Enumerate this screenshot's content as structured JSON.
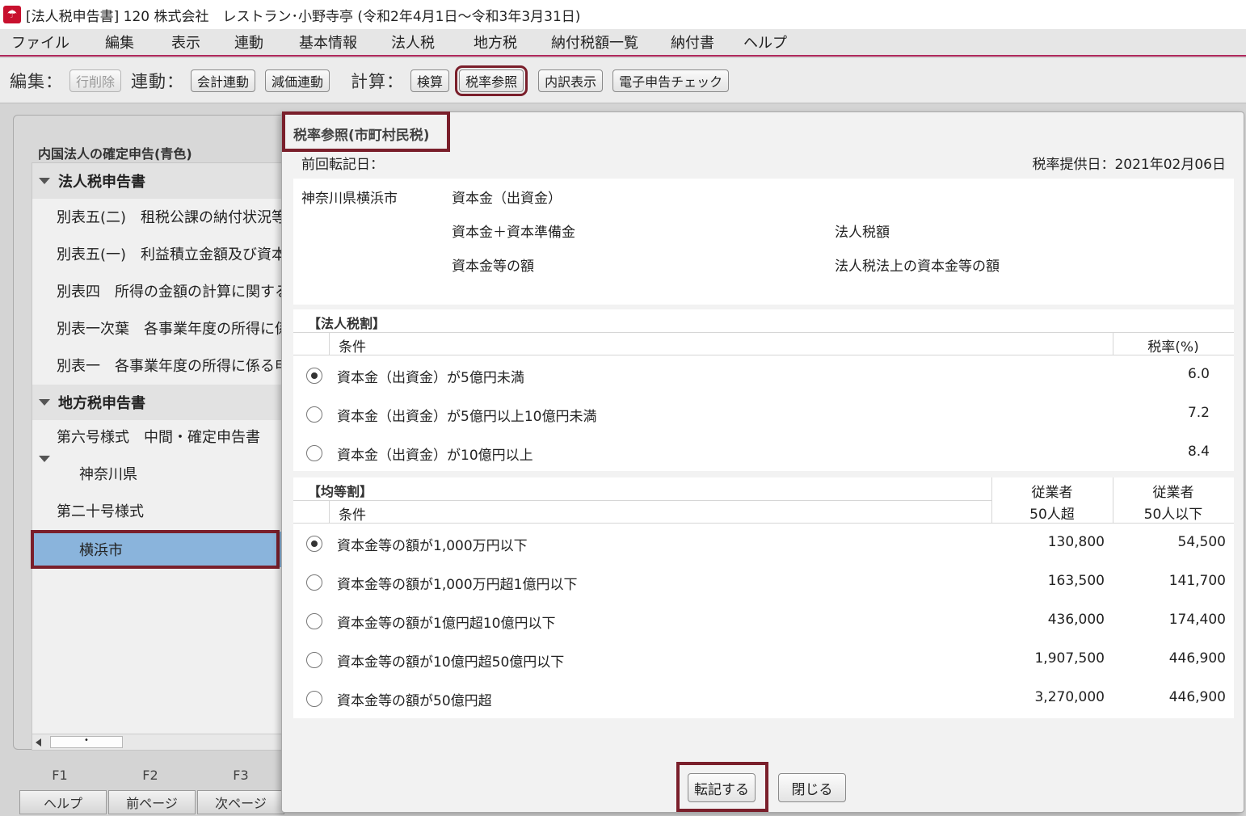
{
  "window": {
    "title": "[法人税申告書] 120 株式会社　レストラン･小野寺亭 (令和2年4月1日～令和3年3月31日)"
  },
  "menu": [
    "ファイル",
    "編集",
    "表示",
    "連動",
    "基本情報",
    "法人税",
    "地方税",
    "納付税額一覧",
    "納付書",
    "ヘルプ"
  ],
  "toolbar": {
    "edit_label": "編集：",
    "delete_row": "行削除",
    "link_label": "連動：",
    "accounting_link": "会計連動",
    "depreciation_link": "減価連動",
    "calc_label": "計算：",
    "check_calc": "検算",
    "tax_rate_ref": "税率参照",
    "breakdown": "内訳表示",
    "e_filing_check": "電子申告チェック"
  },
  "sidebar": {
    "title": "内国法人の確定申告(青色)",
    "items": [
      {
        "label": "法人税申告書",
        "type": "head"
      },
      {
        "label": "別表五(二)　租税公課の納付状況等",
        "type": "item"
      },
      {
        "label": "別表五(一)　利益積立金額及び資本金",
        "type": "item"
      },
      {
        "label": "別表四　所得の金額の計算に関する明細書",
        "type": "item"
      },
      {
        "label": "別表一次葉　各事業年度の所得に係る",
        "type": "item"
      },
      {
        "label": "別表一　各事業年度の所得に係る申告書",
        "type": "item"
      },
      {
        "label": "地方税申告書",
        "type": "head"
      },
      {
        "label": "第六号様式　中間・確定申告書",
        "type": "item"
      },
      {
        "label": "神奈川県",
        "type": "sub"
      },
      {
        "label": "第二十号様式",
        "type": "item"
      },
      {
        "label": "横浜市",
        "type": "selected"
      }
    ]
  },
  "fkeys": [
    {
      "key": "F1",
      "label": "ヘルプ"
    },
    {
      "key": "F2",
      "label": "前ページ"
    },
    {
      "key": "F3",
      "label": "次ページ"
    }
  ],
  "dialog": {
    "title": "税率参照(市町村民税)",
    "last_posted": "前回転記日：",
    "rate_date": "税率提供日：2021年02月06日",
    "info": {
      "city": "神奈川県横浜市",
      "capital": "資本金（出資金）",
      "capital_plus_reserve": "資本金＋資本準備金",
      "corp_tax_amount": "法人税額",
      "capital_equiv": "資本金等の額",
      "corp_tax_law_capital": "法人税法上の資本金等の額"
    },
    "corp_tax_section": {
      "title": "【法人税割】",
      "cond_header": "条件",
      "rate_header": "税率(%)",
      "rows": [
        {
          "cond": "資本金（出資金）が5億円未満",
          "rate": "6.0",
          "checked": true
        },
        {
          "cond": "資本金（出資金）が5億円以上10億円未満",
          "rate": "7.2",
          "checked": false
        },
        {
          "cond": "資本金（出資金）が10億円以上",
          "rate": "8.4",
          "checked": false
        }
      ]
    },
    "per_capita_section": {
      "title": "【均等割】",
      "cond_header": "条件",
      "col1_header_1": "従業者",
      "col1_header_2": "50人超",
      "col2_header_1": "従業者",
      "col2_header_2": "50人以下",
      "rows": [
        {
          "cond": "資本金等の額が1,000万円以下",
          "over50": "130,800",
          "under50": "54,500",
          "checked": true
        },
        {
          "cond": "資本金等の額が1,000万円超1億円以下",
          "over50": "163,500",
          "under50": "141,700",
          "checked": false
        },
        {
          "cond": "資本金等の額が1億円超10億円以下",
          "over50": "436,000",
          "under50": "174,400",
          "checked": false
        },
        {
          "cond": "資本金等の額が10億円超50億円以下",
          "over50": "1,907,500",
          "under50": "446,900",
          "checked": false
        },
        {
          "cond": "資本金等の額が50億円超",
          "over50": "3,270,000",
          "under50": "446,900",
          "checked": false
        }
      ]
    },
    "post_button": "転記する",
    "close_button": "閉じる"
  }
}
